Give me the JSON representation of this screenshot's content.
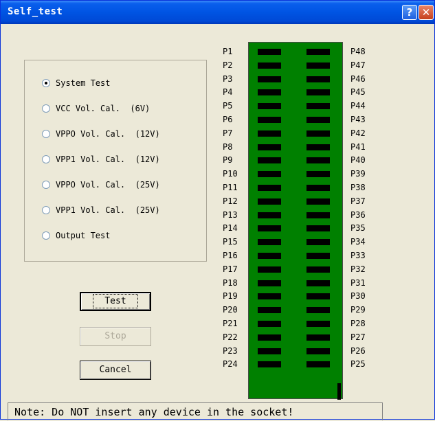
{
  "window": {
    "title": "Self_test",
    "help_glyph": "?",
    "close_glyph": "✕",
    "title_bar_color": "#0054e3"
  },
  "test_options": [
    {
      "label": "System Test",
      "selected": true
    },
    {
      "label": "VCC Vol. Cal.  (6V)",
      "selected": false
    },
    {
      "label": "VPPO Vol. Cal.  (12V)",
      "selected": false
    },
    {
      "label": "VPP1 Vol. Cal.  (12V)",
      "selected": false
    },
    {
      "label": "VPPO Vol. Cal.  (25V)",
      "selected": false
    },
    {
      "label": "VPP1 Vol. Cal.  (25V)",
      "selected": false
    },
    {
      "label": "Output Test",
      "selected": false
    }
  ],
  "buttons": {
    "test": "Test",
    "stop": "Stop",
    "cancel": "Cancel"
  },
  "socket": {
    "color": "#008000",
    "left_pins": [
      "P1",
      "P2",
      "P3",
      "P4",
      "P5",
      "P6",
      "P7",
      "P8",
      "P9",
      "P10",
      "P11",
      "P12",
      "P13",
      "P14",
      "P15",
      "P16",
      "P17",
      "P18",
      "P19",
      "P20",
      "P21",
      "P22",
      "P23",
      "P24"
    ],
    "right_pins": [
      "P48",
      "P47",
      "P46",
      "P45",
      "P44",
      "P43",
      "P42",
      "P41",
      "P40",
      "P39",
      "P38",
      "P37",
      "P36",
      "P35",
      "P34",
      "P33",
      "P32",
      "P31",
      "P30",
      "P29",
      "P28",
      "P27",
      "P26",
      "P25"
    ]
  },
  "status_note": "Note: Do NOT insert any device in the socket!"
}
